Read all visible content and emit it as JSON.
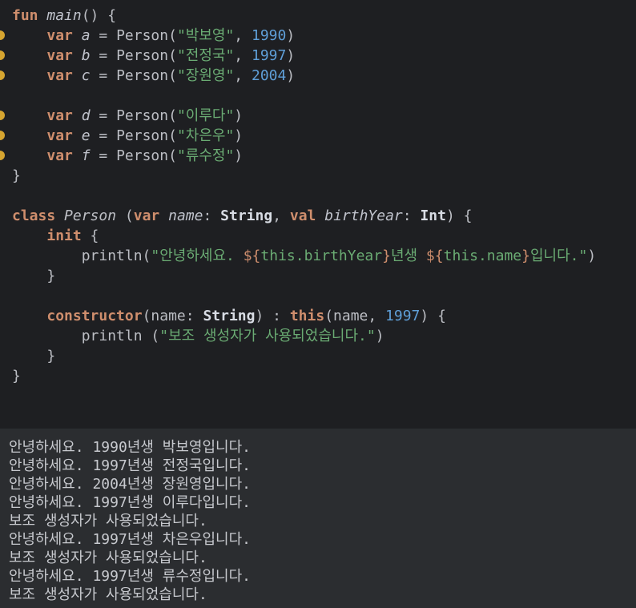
{
  "editor": {
    "lines": [
      {
        "t": "fun main() {",
        "p": [
          [
            "kw",
            "fun"
          ],
          [
            "pun",
            " "
          ],
          [
            "italfn",
            "main"
          ],
          [
            "pun",
            "() {"
          ]
        ]
      },
      {
        "dot": true,
        "p": [
          [
            "pun",
            "    "
          ],
          [
            "kw",
            "var"
          ],
          [
            "pun",
            " "
          ],
          [
            "ital",
            "a"
          ],
          [
            "pun",
            " = Person("
          ],
          [
            "str",
            "\"박보영\""
          ],
          [
            "pun",
            ", "
          ],
          [
            "num",
            "1990"
          ],
          [
            "pun",
            ")"
          ]
        ]
      },
      {
        "dot": true,
        "p": [
          [
            "pun",
            "    "
          ],
          [
            "kw",
            "var"
          ],
          [
            "pun",
            " "
          ],
          [
            "ital",
            "b"
          ],
          [
            "pun",
            " = Person("
          ],
          [
            "str",
            "\"전정국\""
          ],
          [
            "pun",
            ", "
          ],
          [
            "num",
            "1997"
          ],
          [
            "pun",
            ")"
          ]
        ]
      },
      {
        "dot": true,
        "p": [
          [
            "pun",
            "    "
          ],
          [
            "kw",
            "var"
          ],
          [
            "pun",
            " "
          ],
          [
            "ital",
            "c"
          ],
          [
            "pun",
            " = Person("
          ],
          [
            "str",
            "\"장원영\""
          ],
          [
            "pun",
            ", "
          ],
          [
            "num",
            "2004"
          ],
          [
            "pun",
            ")"
          ]
        ]
      },
      {
        "p": []
      },
      {
        "dot": true,
        "p": [
          [
            "pun",
            "    "
          ],
          [
            "kw",
            "var"
          ],
          [
            "pun",
            " "
          ],
          [
            "ital",
            "d"
          ],
          [
            "pun",
            " = Person("
          ],
          [
            "str",
            "\"이루다\""
          ],
          [
            "pun",
            ")"
          ]
        ]
      },
      {
        "dot": true,
        "p": [
          [
            "pun",
            "    "
          ],
          [
            "kw",
            "var"
          ],
          [
            "pun",
            " "
          ],
          [
            "ital",
            "e"
          ],
          [
            "pun",
            " = Person("
          ],
          [
            "str",
            "\"차은우\""
          ],
          [
            "pun",
            ")"
          ]
        ]
      },
      {
        "dot": true,
        "p": [
          [
            "pun",
            "    "
          ],
          [
            "kw",
            "var"
          ],
          [
            "pun",
            " "
          ],
          [
            "ital",
            "f"
          ],
          [
            "pun",
            " = Person("
          ],
          [
            "str",
            "\"류수정\""
          ],
          [
            "pun",
            ")"
          ]
        ]
      },
      {
        "p": [
          [
            "pun",
            "}"
          ]
        ]
      },
      {
        "p": []
      },
      {
        "p": [
          [
            "kw",
            "class"
          ],
          [
            "pun",
            " "
          ],
          [
            "cls",
            "Person"
          ],
          [
            "pun",
            " ("
          ],
          [
            "kw",
            "var"
          ],
          [
            "pun",
            " "
          ],
          [
            "ital",
            "name"
          ],
          [
            "pun",
            ": "
          ],
          [
            "type",
            "String"
          ],
          [
            "pun",
            ", "
          ],
          [
            "kw",
            "val"
          ],
          [
            "pun",
            " "
          ],
          [
            "ital",
            "birthYear"
          ],
          [
            "pun",
            ": "
          ],
          [
            "type",
            "Int"
          ],
          [
            "pun",
            ") {"
          ]
        ]
      },
      {
        "p": [
          [
            "pun",
            "    "
          ],
          [
            "kw",
            "init"
          ],
          [
            "pun",
            " {"
          ]
        ]
      },
      {
        "p": [
          [
            "pun",
            "        println("
          ],
          [
            "str",
            "\"안녕하세요. "
          ],
          [
            "tmpl",
            "${"
          ],
          [
            "str",
            "this.birthYear"
          ],
          [
            "tmpl",
            "}"
          ],
          [
            "str",
            "년생 "
          ],
          [
            "tmpl",
            "${"
          ],
          [
            "str",
            "this.name"
          ],
          [
            "tmpl",
            "}"
          ],
          [
            "str",
            "입니다.\""
          ],
          [
            "pun",
            ")"
          ]
        ]
      },
      {
        "p": [
          [
            "pun",
            "    }"
          ]
        ]
      },
      {
        "p": []
      },
      {
        "p": [
          [
            "pun",
            "    "
          ],
          [
            "kw",
            "constructor"
          ],
          [
            "pun",
            "(name: "
          ],
          [
            "type",
            "String"
          ],
          [
            "pun",
            ") : "
          ],
          [
            "kw",
            "this"
          ],
          [
            "pun",
            "(name, "
          ],
          [
            "num",
            "1997"
          ],
          [
            "pun",
            ") {"
          ]
        ]
      },
      {
        "p": [
          [
            "pun",
            "        println ("
          ],
          [
            "str",
            "\"보조 생성자가 사용되었습니다.\""
          ],
          [
            "pun",
            ")"
          ]
        ]
      },
      {
        "p": [
          [
            "pun",
            "    }"
          ]
        ]
      },
      {
        "p": [
          [
            "pun",
            "}"
          ]
        ]
      }
    ]
  },
  "console": {
    "lines": [
      "안녕하세요. 1990년생 박보영입니다.",
      "안녕하세요. 1997년생 전정국입니다.",
      "안녕하세요. 2004년생 장원영입니다.",
      "안녕하세요. 1997년생 이루다입니다.",
      "보조 생성자가 사용되었습니다.",
      "안녕하세요. 1997년생 차은우입니다.",
      "보조 생성자가 사용되었습니다.",
      "안녕하세요. 1997년생 류수정입니다.",
      "보조 생성자가 사용되었습니다."
    ]
  },
  "colors": {
    "keyword": "#cf8e6d",
    "string": "#6aab73",
    "number": "#5f9fd8",
    "editor_bg": "#1e1f22",
    "console_bg": "#2b2d30",
    "breakpoint_dot": "#d6a530"
  }
}
